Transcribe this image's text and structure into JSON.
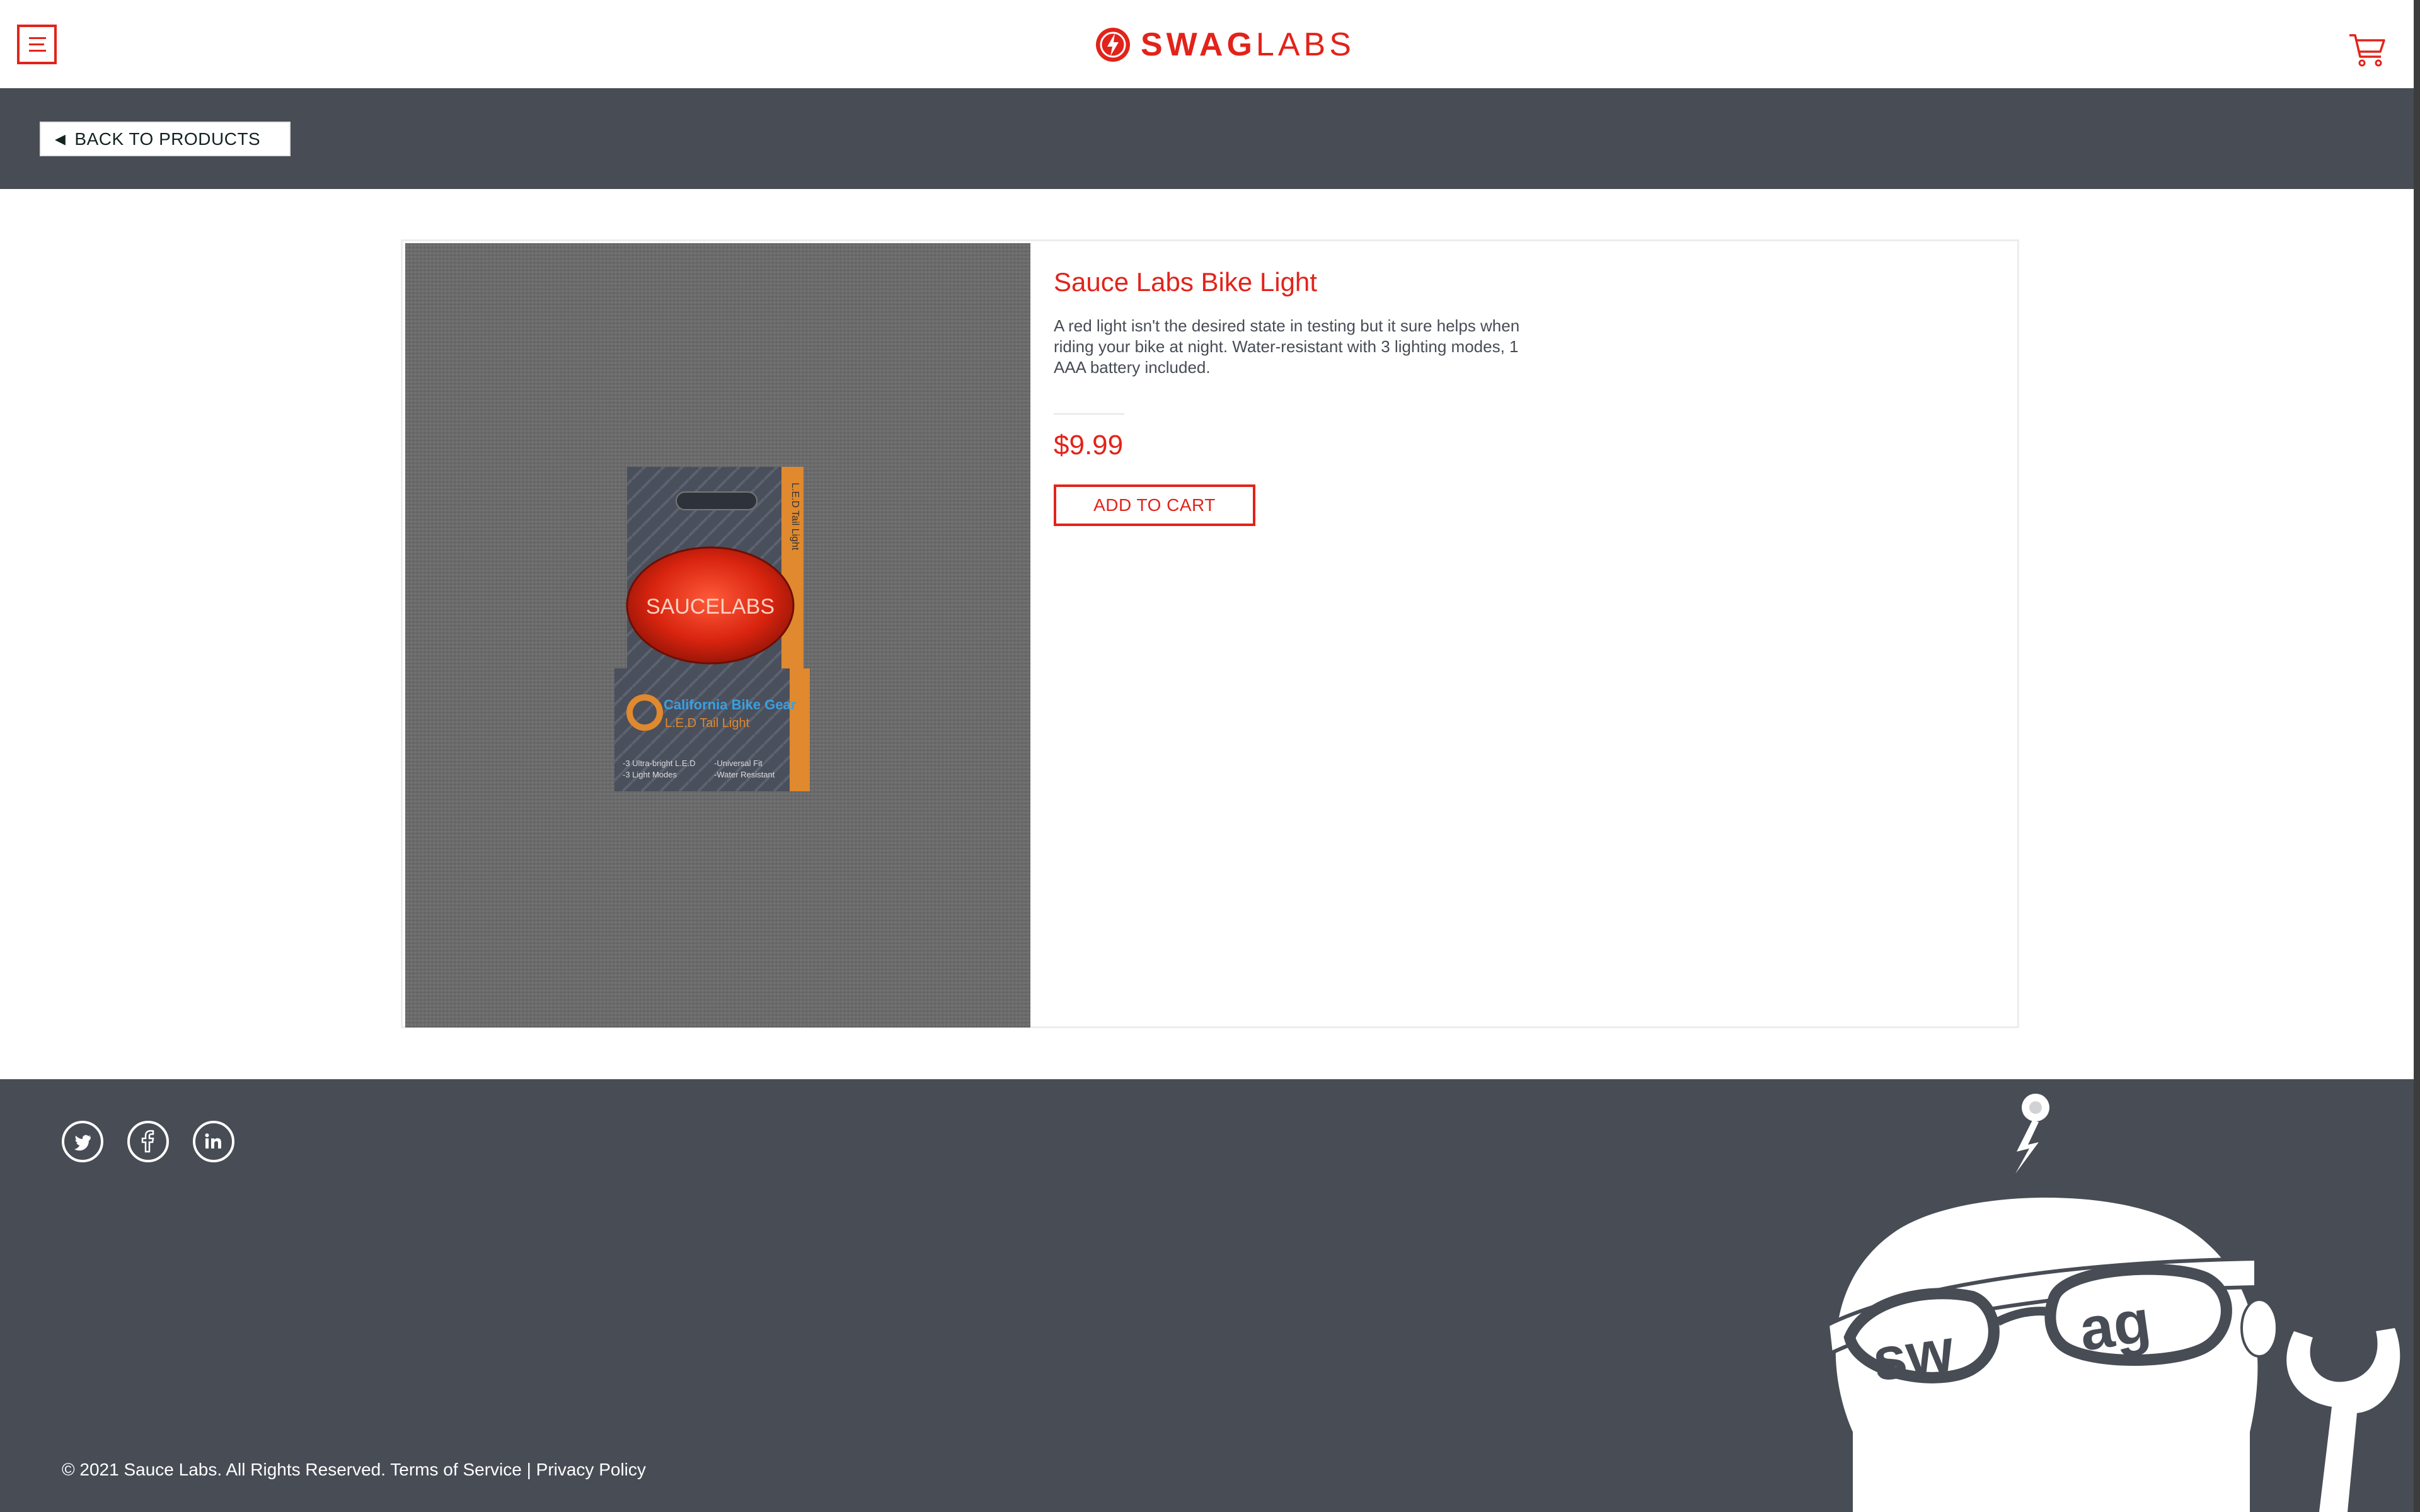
{
  "header": {
    "logo_text_bold": "SWAG",
    "logo_text_light": "LABS",
    "menu_icon": "hamburger-menu-icon",
    "cart_icon": "shopping-cart-icon"
  },
  "subheader": {
    "back_label": "BACK TO PRODUCTS",
    "back_icon": "triangle-left-icon"
  },
  "product": {
    "name": "Sauce Labs Bike Light",
    "description": "A red light isn't the desired state in testing but it sure helps when riding your bike at night. Water-resistant with 3 lighting modes, 1 AAA battery included.",
    "price": "$9.99",
    "add_to_cart_label": "ADD TO CART",
    "image_package_brand": "SAUCELABS",
    "image_package_line1": "California Bike Gear",
    "image_package_line2": "L.E.D Tail Light",
    "image_package_side": "L.E.D Tail Light",
    "image_features": [
      "-3 Ultra-bright L.E.D",
      "-3 Light Modes",
      "-Universal Fit",
      "-Water Resistant"
    ]
  },
  "footer": {
    "social": [
      "twitter-icon",
      "facebook-icon",
      "linkedin-icon"
    ],
    "copyright": "© 2021 Sauce Labs. All Rights Reserved. Terms of Service | Privacy Policy",
    "mascot_text": "sw ag"
  },
  "colors": {
    "accent": "#e2231a",
    "dark_bar": "#474c55",
    "text": "#484c55",
    "background": "#ffffff"
  }
}
